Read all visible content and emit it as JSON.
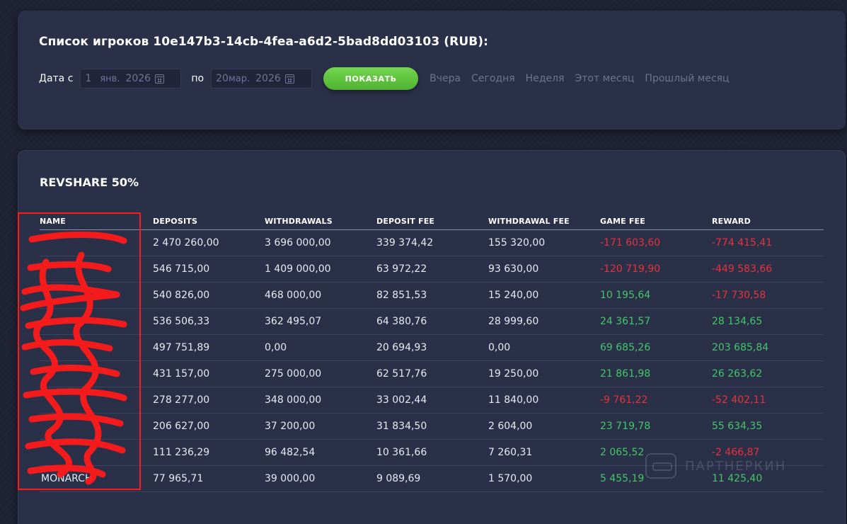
{
  "header": {
    "title": "Список игроков 10e147b3-14cb-4fea-a6d2-5bad8dd03103 (RUB):",
    "date_from_label": "Дата с",
    "date_to_label": "по",
    "date_from": {
      "day": "1",
      "month": "янв.",
      "year": "2026"
    },
    "date_to": {
      "day": "20",
      "month": "мар.",
      "year": "2026"
    },
    "show_button": "ПОКАЗАТЬ",
    "quick_ranges": [
      "Вчера",
      "Сегодня",
      "Неделя",
      "Этот месяц",
      "Прошлый месяц"
    ]
  },
  "report": {
    "title": "REVSHARE 50%",
    "columns": [
      "NAME",
      "DEPOSITS",
      "WITHDRAWALS",
      "DEPOSIT FEE",
      "WITHDRAWAL FEE",
      "GAME FEE",
      "REWARD"
    ],
    "rows": [
      {
        "name": "",
        "deposits": "2 470 260,00",
        "withdrawals": "3 696 000,00",
        "deposit_fee": "339 374,42",
        "withdrawal_fee": "155 320,00",
        "game_fee": "-171 603,60",
        "reward": "-774 415,41"
      },
      {
        "name": "",
        "deposits": "546 715,00",
        "withdrawals": "1 409 000,00",
        "deposit_fee": "63 972,22",
        "withdrawal_fee": "93 630,00",
        "game_fee": "-120 719,90",
        "reward": "-449 583,66"
      },
      {
        "name": "",
        "deposits": "540 826,00",
        "withdrawals": "468 000,00",
        "deposit_fee": "82 851,53",
        "withdrawal_fee": "15 240,00",
        "game_fee": "10 195,64",
        "reward": "-17 730,58"
      },
      {
        "name": "",
        "deposits": "536 506,33",
        "withdrawals": "362 495,07",
        "deposit_fee": "64 380,76",
        "withdrawal_fee": "28 999,60",
        "game_fee": "24 361,57",
        "reward": "28 134,65"
      },
      {
        "name": "",
        "deposits": "497 751,89",
        "withdrawals": "0,00",
        "deposit_fee": "20 694,93",
        "withdrawal_fee": "0,00",
        "game_fee": "69 685,26",
        "reward": "203 685,84"
      },
      {
        "name": "",
        "deposits": "431 157,00",
        "withdrawals": "275 000,00",
        "deposit_fee": "62 517,76",
        "withdrawal_fee": "19 250,00",
        "game_fee": "21 861,98",
        "reward": "26 263,62"
      },
      {
        "name": "",
        "deposits": "278 277,00",
        "withdrawals": "348 000,00",
        "deposit_fee": "33 002,44",
        "withdrawal_fee": "11 840,00",
        "game_fee": "-9 761,22",
        "reward": "-52 402,11"
      },
      {
        "name": "",
        "deposits": "206 627,00",
        "withdrawals": "37 200,00",
        "deposit_fee": "31 834,50",
        "withdrawal_fee": "2 604,00",
        "game_fee": "23 719,78",
        "reward": "55 634,35"
      },
      {
        "name": "",
        "deposits": "111 236,29",
        "withdrawals": "96 482,54",
        "deposit_fee": "10 361,66",
        "withdrawal_fee": "7 260,31",
        "game_fee": "2 065,52",
        "reward": "-2 466,87"
      },
      {
        "name": "MONARCH",
        "deposits": "77 965,71",
        "withdrawals": "39 000,00",
        "deposit_fee": "9 089,69",
        "withdrawal_fee": "1 570,00",
        "game_fee": "5 455,19",
        "reward": "11 425,40"
      }
    ]
  },
  "watermark": {
    "text": "ПАРТНЕРКИН",
    "icon": "chat-bubble-icon"
  },
  "colors": {
    "positive": "#45c66a",
    "negative": "#e8323a",
    "button": "#5fc93f",
    "redaction": "#ff1a1a"
  }
}
